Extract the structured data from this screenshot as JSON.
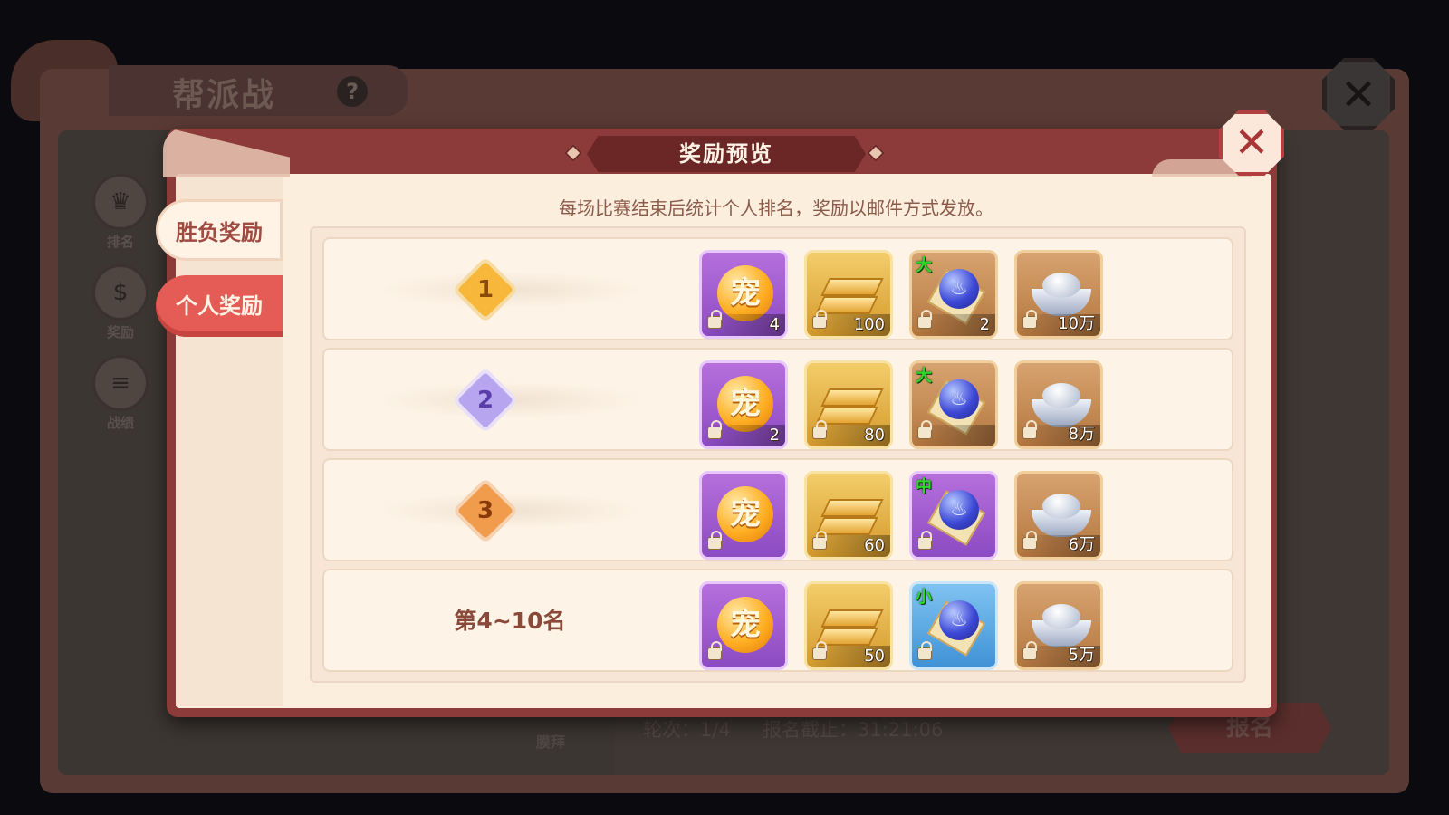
{
  "background": {
    "title": "帮派战",
    "help_label": "?",
    "close_label": "✕",
    "side_menu": [
      {
        "label": "排名",
        "icon": "ranking-icon"
      },
      {
        "label": "奖励",
        "icon": "reward-bag-icon"
      },
      {
        "label": "战绩",
        "icon": "scroll-icon"
      }
    ],
    "worship_label": "膜拜",
    "round_text": "轮次：1/4",
    "deadline_text": "报名截止：31:21:06",
    "signup_label": "报名"
  },
  "dialog": {
    "title": "奖励预览",
    "close_label": "✕",
    "tabs": [
      {
        "label": "胜负奖励",
        "active": false
      },
      {
        "label": "个人奖励",
        "active": true
      }
    ],
    "notice": "每场比赛结束后统计个人排名，奖励以邮件方式发放。",
    "rows": [
      {
        "rank_label": "1",
        "rank_style": "gold-medal",
        "items": [
          {
            "icon": "pet-orb-icon",
            "glyph": "宠",
            "count": "4",
            "frame": "purple",
            "locked": true
          },
          {
            "icon": "gold-bar-icon",
            "count": "100",
            "frame": "gold",
            "locked": true
          },
          {
            "icon": "crystal-sphere-icon",
            "tag": "大",
            "count": "2",
            "frame": "bronze",
            "locked": true
          },
          {
            "icon": "silver-ingot-icon",
            "count": "10万",
            "frame": "bronze",
            "locked": true
          }
        ]
      },
      {
        "rank_label": "2",
        "rank_style": "silver-medal",
        "items": [
          {
            "icon": "pet-orb-icon",
            "glyph": "宠",
            "count": "2",
            "frame": "purple",
            "locked": true
          },
          {
            "icon": "gold-bar-icon",
            "count": "80",
            "frame": "gold",
            "locked": true
          },
          {
            "icon": "crystal-sphere-icon",
            "tag": "大",
            "count": "",
            "frame": "bronze",
            "locked": true
          },
          {
            "icon": "silver-ingot-icon",
            "count": "8万",
            "frame": "bronze",
            "locked": true
          }
        ]
      },
      {
        "rank_label": "3",
        "rank_style": "bronze-medal",
        "items": [
          {
            "icon": "pet-orb-icon",
            "glyph": "宠",
            "count": "",
            "frame": "purple",
            "locked": true
          },
          {
            "icon": "gold-bar-icon",
            "count": "60",
            "frame": "gold",
            "locked": true
          },
          {
            "icon": "crystal-sphere-icon",
            "tag": "中",
            "count": "",
            "frame": "purple",
            "locked": true
          },
          {
            "icon": "silver-ingot-icon",
            "count": "6万",
            "frame": "bronze",
            "locked": true
          }
        ]
      },
      {
        "rank_label": "第4~10名",
        "rank_style": "text",
        "items": [
          {
            "icon": "pet-orb-icon",
            "glyph": "宠",
            "count": "",
            "frame": "purple",
            "locked": true
          },
          {
            "icon": "gold-bar-icon",
            "count": "50",
            "frame": "gold",
            "locked": true
          },
          {
            "icon": "crystal-sphere-icon",
            "tag": "小",
            "count": "",
            "frame": "blue",
            "locked": true
          },
          {
            "icon": "silver-ingot-icon",
            "count": "5万",
            "frame": "bronze",
            "locked": true
          }
        ]
      }
    ]
  }
}
